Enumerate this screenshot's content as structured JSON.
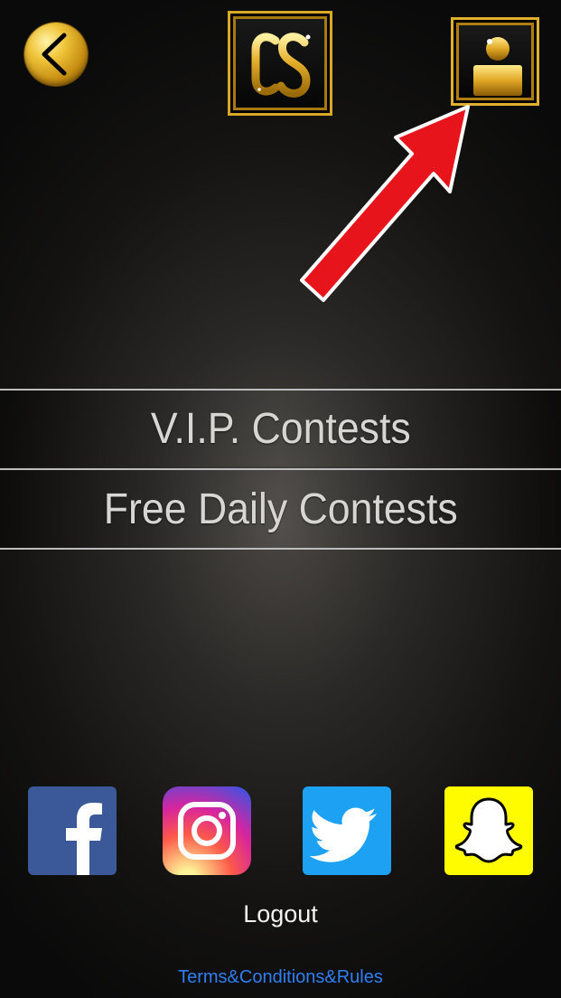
{
  "header": {
    "logo_text": "CS"
  },
  "menu": {
    "items": [
      {
        "label": "V.I.P. Contests"
      },
      {
        "label": "Free Daily Contests"
      }
    ]
  },
  "social": [
    "facebook-icon",
    "instagram-icon",
    "twitter-icon",
    "snapchat-icon"
  ],
  "footer": {
    "logout_label": "Logout",
    "terms_label": "Terms&Conditions&Rules"
  },
  "colors": {
    "gold": "#d9a825",
    "link": "#2f7ff2",
    "arrow": "#e8141c"
  }
}
